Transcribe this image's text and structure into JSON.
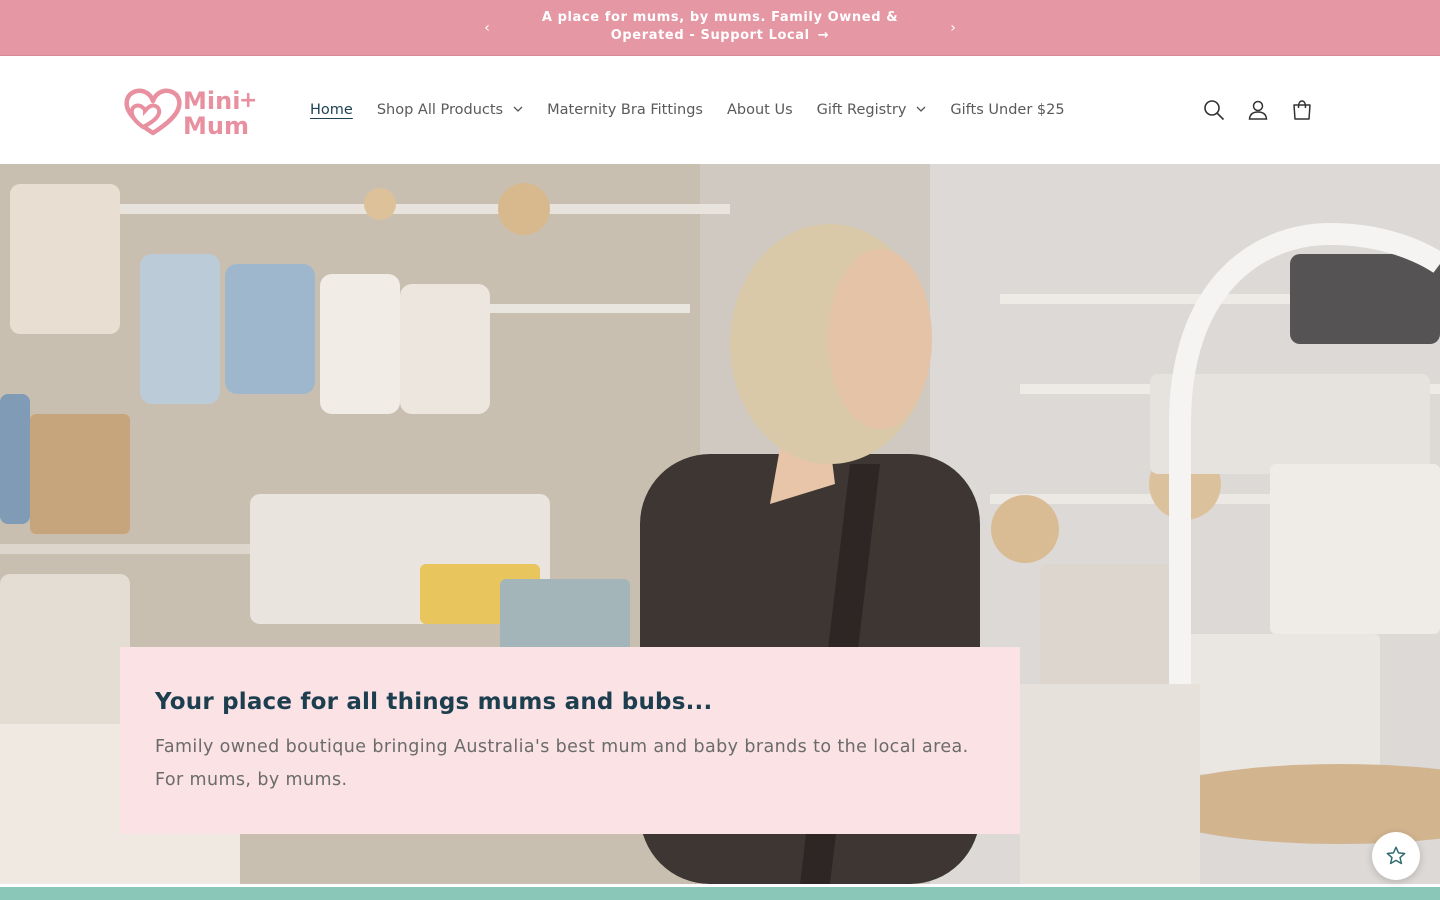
{
  "announcement": {
    "message": "A place for mums, by mums. Family Owned & Operated - Support Local",
    "link_arrow": "→",
    "prev_label": "‹",
    "next_label": "›"
  },
  "header": {
    "logo_text": "Mini+ Mum",
    "nav": [
      {
        "label": "Home",
        "active": true,
        "has_dropdown": false
      },
      {
        "label": "Shop All Products",
        "has_dropdown": true
      },
      {
        "label": "Maternity Bra Fittings",
        "has_dropdown": false
      },
      {
        "label": "About Us",
        "has_dropdown": false
      },
      {
        "label": "Gift Registry",
        "has_dropdown": true
      },
      {
        "label": "Gifts Under $25",
        "has_dropdown": false
      }
    ],
    "dropdown_glyph": "⌄",
    "icons": [
      "search-icon",
      "account-icon",
      "cart-icon"
    ]
  },
  "hero": {
    "title": "Your place for all things mums and bubs...",
    "text": "Family owned boutique bringing Australia's best mum and baby brands to the local area. For mums, by mums."
  },
  "colors": {
    "announcement_bg": "#e597a4",
    "brand_pink": "#e88fa0",
    "heading_navy": "#1d3e4e",
    "card_bg": "#fae2e5",
    "bottom_strip": "#8ac7b8"
  },
  "floating_widget": {
    "icon": "star-icon"
  }
}
